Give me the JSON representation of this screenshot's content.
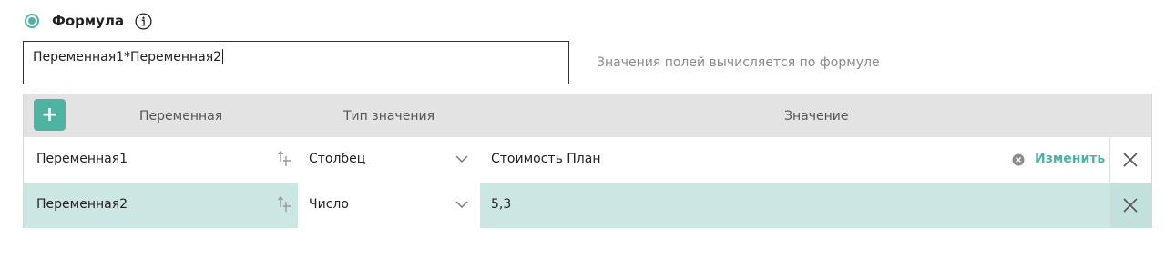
{
  "header": {
    "title": "Формула",
    "info_icon": "info-icon"
  },
  "formula": {
    "value": "Переменная1*Переменная2",
    "hint": "Значения полей вычисляется по формуле"
  },
  "table": {
    "add_label": "+",
    "columns": [
      "Переменная",
      "Тип значения",
      "Значение"
    ],
    "rows": [
      {
        "variable": "Переменная1",
        "type": "Столбец",
        "value": "Стоимость План",
        "action": "Изменить"
      },
      {
        "variable": "Переменная2",
        "type": "Число",
        "value": "5,3"
      }
    ]
  },
  "colors": {
    "accent": "#4fb3a2",
    "selected_row": "#cce7e3",
    "header_bg": "#e3e3e3"
  }
}
